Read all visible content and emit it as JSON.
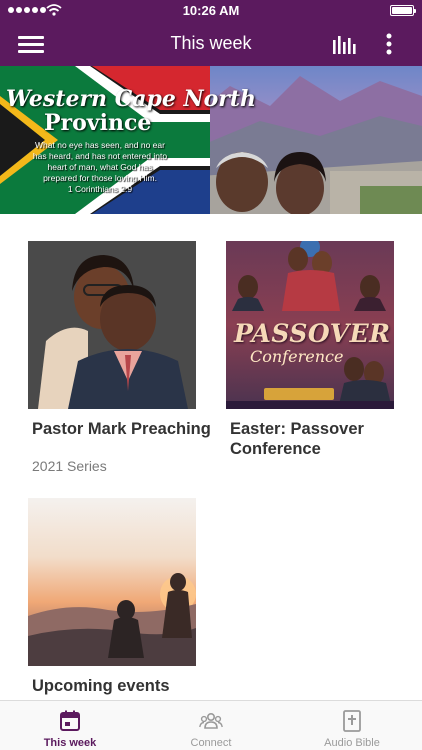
{
  "status_bar": {
    "time": "10:26 AM"
  },
  "nav": {
    "title": "This week"
  },
  "hero": {
    "title_line1": "Western Cape North",
    "title_line2": "Province",
    "verse": "What no eye has seen, and no ear has heard, and has not entered into heart of man, what God has prepared for those loving Him.",
    "verse_ref": "1 Corinthians 2:9"
  },
  "cards": [
    {
      "title": "Pastor Mark Preaching",
      "subtitle": "2021 Series"
    },
    {
      "title": "Easter: Passover Conference",
      "subtitle": ""
    },
    {
      "title": "Upcoming events",
      "subtitle": ""
    }
  ],
  "card2_poster": {
    "headline": "PASSOVER",
    "subhead": "Conference"
  },
  "tab_bar": {
    "tabs": [
      {
        "label": "This week",
        "icon": "calendar-icon",
        "active": true
      },
      {
        "label": "Connect",
        "icon": "group-icon",
        "active": false
      },
      {
        "label": "Audio Bible",
        "icon": "bible-icon",
        "active": false
      }
    ]
  },
  "colors": {
    "brand": "#5b1a5e",
    "tab_inactive": "#9a9a9a",
    "card_title": "#333333",
    "card_subtitle": "#7a7a7a"
  }
}
